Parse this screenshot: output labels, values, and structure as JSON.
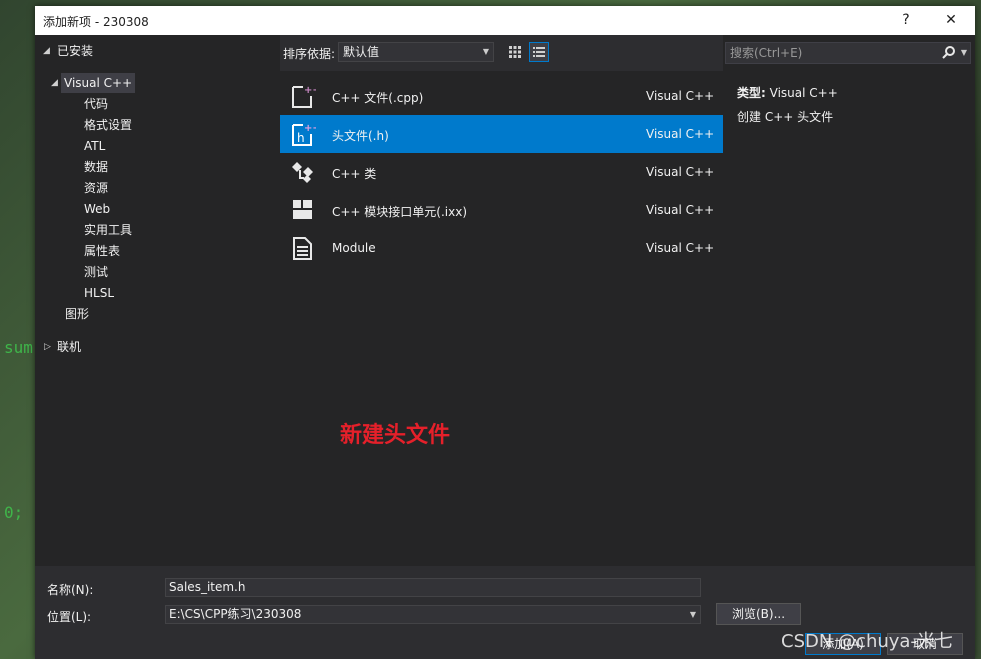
{
  "window": {
    "title": "添加新项 - 230308",
    "help_label": "?",
    "close_label": "✕"
  },
  "background": {
    "code_line_1": "sum",
    "code_line_2": "0; ·"
  },
  "sidebar": {
    "installed_label": "已安装",
    "root": "Visual C++",
    "children": [
      "代码",
      "格式设置",
      "ATL",
      "数据",
      "资源",
      "Web",
      "实用工具",
      "属性表",
      "测试",
      "HLSL"
    ],
    "graphics": "图形",
    "online": "联机"
  },
  "toolbar": {
    "sort_label": "排序依据:",
    "sort_value": "默认值"
  },
  "templates": [
    {
      "name": "C++ 文件(.cpp)",
      "lang": "Visual C++",
      "icon": "cpp-file-icon"
    },
    {
      "name": "头文件(.h)",
      "lang": "Visual C++",
      "icon": "header-file-icon"
    },
    {
      "name": "C++ 类",
      "lang": "Visual C++",
      "icon": "class-icon"
    },
    {
      "name": "C++ 模块接口单元(.ixx)",
      "lang": "Visual C++",
      "icon": "module-interface-icon"
    },
    {
      "name": "Module",
      "lang": "Visual C++",
      "icon": "module-icon"
    }
  ],
  "annotation": "新建头文件",
  "details": {
    "search_placeholder": "搜索(Ctrl+E)",
    "type_key": "类型:",
    "type_value": "Visual C++",
    "description": "创建 C++ 头文件"
  },
  "form": {
    "name_label": "名称(N):",
    "name_value": "Sales_item.h",
    "location_label": "位置(L):",
    "location_value": "E:\\CS\\CPP练习\\230308",
    "browse_label": "浏览(B)...",
    "add_label": "添加(A)",
    "cancel_label": "取消"
  },
  "watermark": "CSDN @chuya-米七",
  "colors": {
    "accent": "#007acc",
    "annotation": "#e5202a",
    "dialog_bg": "#2d2d30",
    "panel_bg": "#252526"
  }
}
